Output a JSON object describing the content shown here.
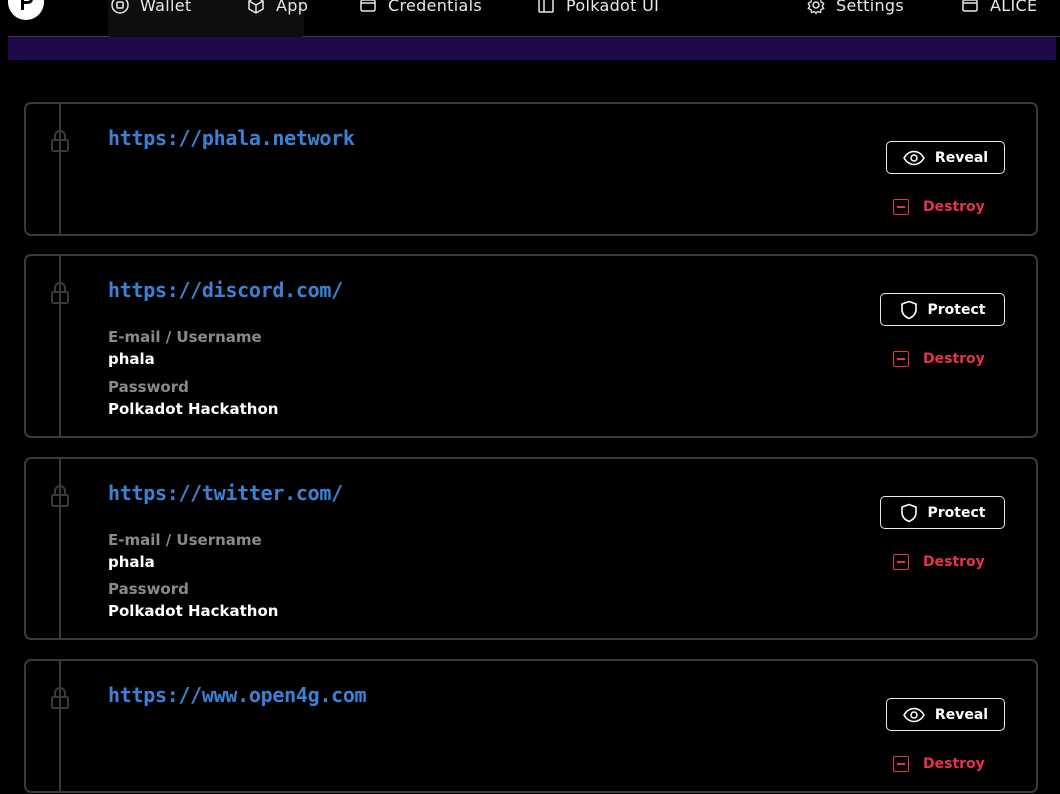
{
  "nav": {
    "items": [
      {
        "label": "Wallet",
        "icon": "wallet-icon"
      },
      {
        "label": "App",
        "icon": "cube-icon"
      },
      {
        "label": "Credentials",
        "icon": "folder-icon"
      },
      {
        "label": "Polkadot UI",
        "icon": "layout-icon"
      },
      {
        "label": "Settings",
        "icon": "gear-icon"
      },
      {
        "label": "ALICE",
        "icon": "account-icon"
      }
    ]
  },
  "credentials": [
    {
      "url": "https://phala.network",
      "action_label": "Reveal",
      "destroy_label": "Destroy"
    },
    {
      "url": "https://discord.com/",
      "username_label": "E-mail / Username",
      "username": "phala",
      "password_label": "Password",
      "password": "Polkadot Hackathon",
      "action_label": "Protect",
      "destroy_label": "Destroy"
    },
    {
      "url": "https://twitter.com/",
      "username_label": "E-mail / Username",
      "username": "phala",
      "password_label": "Password",
      "password": "Polkadot Hackathon",
      "action_label": "Protect",
      "destroy_label": "Destroy"
    },
    {
      "url": "https://www.open4g.com",
      "action_label": "Reveal",
      "destroy_label": "Destroy"
    }
  ],
  "colors": {
    "link": "#3b82d6",
    "danger": "#e8324b",
    "band": "#1e0a4a"
  }
}
